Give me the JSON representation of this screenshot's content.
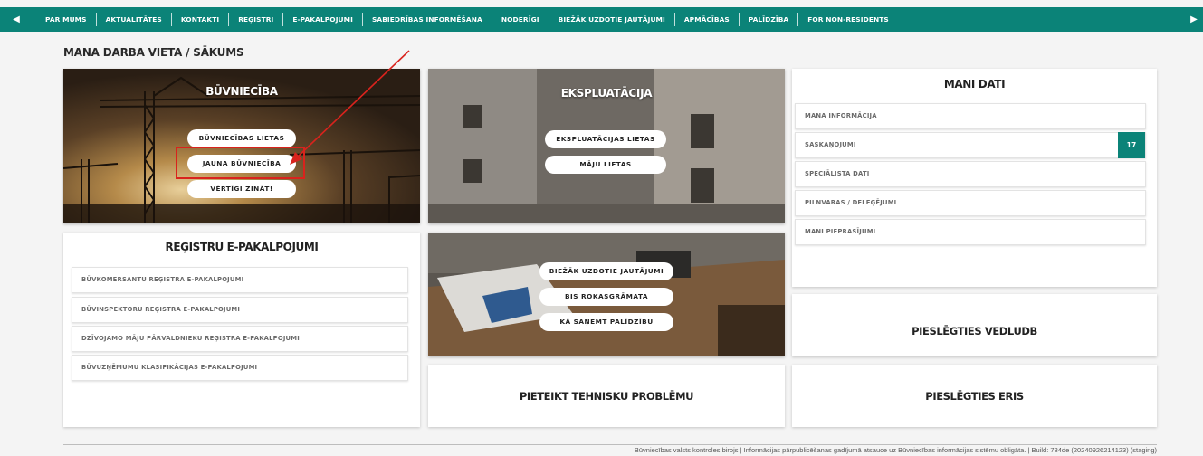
{
  "nav": {
    "items": [
      "PAR MUMS",
      "AKTUALITĀTES",
      "KONTAKTI",
      "REĢISTRI",
      "E-PAKALPOJUMI",
      "SABIEDRĪBAS INFORMĒŠANA",
      "NODERĪGI",
      "BIEŽĀK UZDOTIE JAUTĀJUMI",
      "APMĀCĪBAS",
      "PALĪDZĪBA",
      "FOR NON-RESIDENTS"
    ],
    "left_arrow_icon": "triangle-left",
    "right_arrow_icon": "triangle-right",
    "color": "#0b8378"
  },
  "page_title": "MANA DARBA VIETA / SĀKUMS",
  "buvnieciba": {
    "title": "BŪVNIECĪBA",
    "buttons": [
      "BŪVNIECĪBAS LIETAS",
      "JAUNA BŪVNIECĪBA",
      "VĒRTĪGI ZINĀT!"
    ]
  },
  "ekspluatacija": {
    "title": "EKSPLUATĀCIJA",
    "buttons": [
      "EKSPLUATĀCIJAS LIETAS",
      "MĀJU LIETAS"
    ]
  },
  "mani_dati": {
    "title": "MANI DATI",
    "items": [
      {
        "label": "MANA INFORMĀCIJA"
      },
      {
        "label": "SASKAŅOJUMI",
        "badge": "17"
      },
      {
        "label": "SPECIĀLISTA DATI"
      },
      {
        "label": "PILNVARAS / DELEĢĒJUMI"
      },
      {
        "label": "MANI PIEPRASĪJUMI"
      }
    ]
  },
  "registri": {
    "title": "REĢISTRU E-PAKALPOJUMI",
    "items": [
      "BŪVKOMERSANTU REĢISTRA E-PAKALPOJUMI",
      "BŪVINSPEKTORU REĢISTRA E-PAKALPOJUMI",
      "DZĪVOJAMO MĀJU PĀRVALDNIEKU REĢISTRA E-PAKALPOJUMI",
      "BŪVUZŅĒMUMU KLASIFIKĀCIJAS E-PAKALPOJUMI"
    ]
  },
  "help": {
    "buttons": [
      "BIEŽĀK UZDOTIE JAUTĀJUMI",
      "BIS ROKASGRĀMATA",
      "KĀ SAŅEMT PALĪDZĪBU"
    ]
  },
  "links": {
    "vedludb": "PIESLĒGTIES VEDLUDB",
    "problem": "PIETEIKT TEHNISKU PROBLĒMU",
    "eris": "PIESLĒGTIES ERIS"
  },
  "footer": "Būvniecības valsts kontroles birojs | Informācijas pārpublicēšanas gadījumā atsauce uz Būvniecības informācijas sistēmu obligāta. | Build: 784de (20240926214123) (staging)",
  "annotation_color": "#d9231d"
}
